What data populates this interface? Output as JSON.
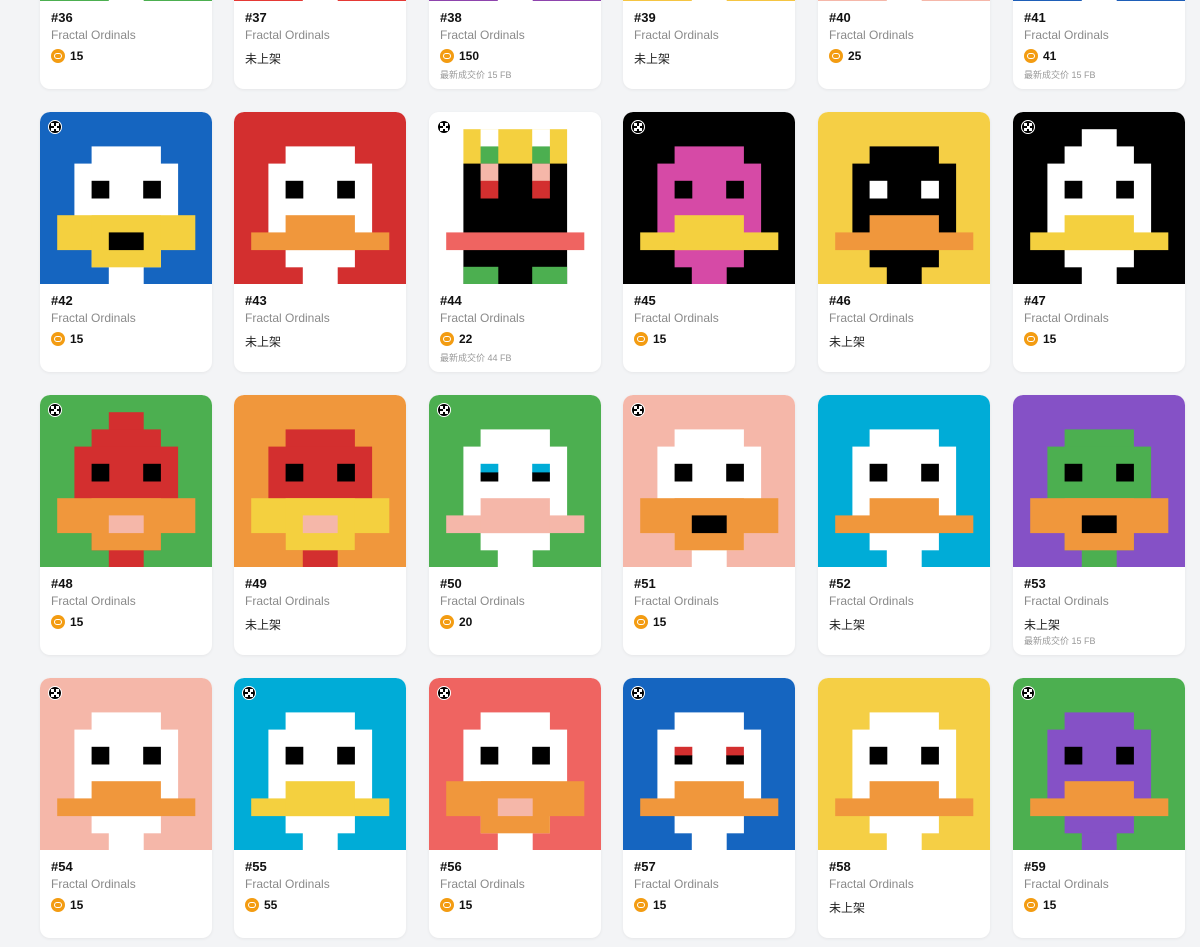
{
  "collection_name": "Fractal Ordinals",
  "unlisted_text": "未上架",
  "last_sale_prefix": "最新成交价",
  "items": [
    {
      "id": "#36",
      "bg": "#4caf50",
      "body": "#ffffff",
      "beak": "#f4d03f",
      "sale": "15",
      "last": null,
      "badge": false
    },
    {
      "id": "#37",
      "bg": "#e53935",
      "body": "#ffffff",
      "beak": "#f0973c",
      "sale": null,
      "last": null,
      "badge": false
    },
    {
      "id": "#38",
      "bg": "#8e44ad",
      "body": "#ffffff",
      "beak": "#f0973c",
      "sale": "150",
      "last": "15 FB",
      "badge": false
    },
    {
      "id": "#39",
      "bg": "#f5c542",
      "body": "#ffffff",
      "beak": "#f0973c",
      "sale": null,
      "last": null,
      "badge": false
    },
    {
      "id": "#40",
      "bg": "#f5b7a9",
      "body": "#ffffff",
      "beak": "#f0973c",
      "sale": "25",
      "last": null,
      "badge": false
    },
    {
      "id": "#41",
      "bg": "#1e5eb8",
      "body": "#ffffff",
      "beak": "#f4d03f",
      "sale": "41",
      "last": "15 FB",
      "badge": false
    },
    {
      "id": "#42",
      "bg": "#1565c0",
      "body": "#ffffff",
      "beak": "#f4d03f",
      "sale": "15",
      "last": null,
      "badge": true,
      "style": "yellowbeak"
    },
    {
      "id": "#43",
      "bg": "#d32f2f",
      "body": "#ffffff",
      "beak": "#f0973c",
      "sale": null,
      "last": null,
      "badge": false
    },
    {
      "id": "#44",
      "bg": "#ffffff",
      "body": "#000000",
      "beak": "#ef6461",
      "sale": "22",
      "last": "44 FB",
      "badge": true,
      "style": "crown"
    },
    {
      "id": "#45",
      "bg": "#000000",
      "body": "#d64aa6",
      "beak": "#f4d03f",
      "sale": "15",
      "last": null,
      "badge": true
    },
    {
      "id": "#46",
      "bg": "#f5cf45",
      "body": "#000000",
      "beak": "#f0973c",
      "sale": null,
      "last": null,
      "badge": false,
      "style": "whiteeyes"
    },
    {
      "id": "#47",
      "bg": "#000000",
      "body": "#ffffff",
      "beak": "#f4d03f",
      "sale": "15",
      "last": null,
      "badge": true,
      "style": "pointy"
    },
    {
      "id": "#48",
      "bg": "#4caf50",
      "body": "#d32f2f",
      "beak": "#f0973c",
      "sale": "15",
      "last": null,
      "badge": true,
      "style": "pointy-pink"
    },
    {
      "id": "#49",
      "bg": "#f0973c",
      "body": "#d32f2f",
      "beak": "#f4d03f",
      "sale": null,
      "last": null,
      "badge": false,
      "style": "pink"
    },
    {
      "id": "#50",
      "bg": "#4caf50",
      "body": "#ffffff",
      "beak": "#f5b7a9",
      "sale": "20",
      "last": null,
      "badge": true,
      "style": "blueeyes"
    },
    {
      "id": "#51",
      "bg": "#f5b7a9",
      "body": "#ffffff",
      "beak": "#f0973c",
      "sale": "15",
      "last": null,
      "badge": true,
      "style": "mouth"
    },
    {
      "id": "#52",
      "bg": "#00acd7",
      "body": "#ffffff",
      "beak": "#f0973c",
      "sale": null,
      "last": null,
      "badge": false
    },
    {
      "id": "#53",
      "bg": "#8551c6",
      "body": "#4caf50",
      "beak": "#f0973c",
      "sale": null,
      "last": "15 FB",
      "badge": false,
      "style": "mouth"
    },
    {
      "id": "#54",
      "bg": "#f5b7a9",
      "body": "#ffffff",
      "beak": "#f0973c",
      "sale": "15",
      "last": null,
      "badge": true
    },
    {
      "id": "#55",
      "bg": "#00acd7",
      "body": "#ffffff",
      "beak": "#f4d03f",
      "sale": "55",
      "last": null,
      "badge": true
    },
    {
      "id": "#56",
      "bg": "#ef6461",
      "body": "#ffffff",
      "beak": "#f0973c",
      "sale": "15",
      "last": null,
      "badge": true,
      "style": "pink"
    },
    {
      "id": "#57",
      "bg": "#1565c0",
      "body": "#ffffff",
      "beak": "#f0973c",
      "sale": "15",
      "last": null,
      "badge": true,
      "style": "redeyes"
    },
    {
      "id": "#58",
      "bg": "#f5cf45",
      "body": "#ffffff",
      "beak": "#f0973c",
      "sale": null,
      "last": null,
      "badge": false
    },
    {
      "id": "#59",
      "bg": "#4caf50",
      "body": "#8551c6",
      "beak": "#f0973c",
      "sale": "15",
      "last": null,
      "badge": true
    }
  ]
}
